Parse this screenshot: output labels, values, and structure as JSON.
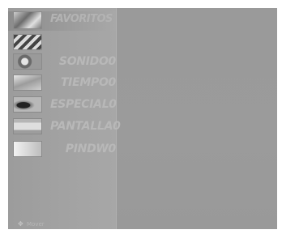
{
  "menu": {
    "title": "FAVORITOS",
    "items": [
      {
        "label": "",
        "icon": "picture-icon"
      },
      {
        "label": "SONIDO0",
        "icon": "sound-icon"
      },
      {
        "label": "TIEMPO0",
        "icon": "time-icon"
      },
      {
        "label": "ESPECIAL0",
        "icon": "special-icon"
      },
      {
        "label": "PANTALLA0",
        "icon": "screen-icon"
      },
      {
        "label": "PINDW0",
        "icon": "pip-icon"
      }
    ],
    "hint": "Mover"
  }
}
